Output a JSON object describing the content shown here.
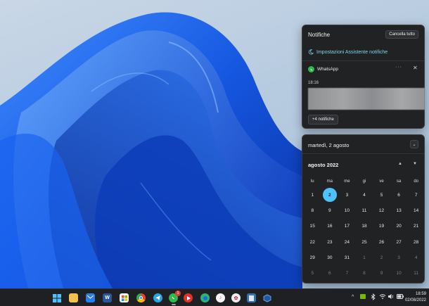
{
  "notifications": {
    "header": "Notifiche",
    "clear_all": "Cancella tutto",
    "assistant_link": "Impostazioni Assistente notifiche",
    "app_name": "WhatsApp",
    "more_dots": "···",
    "close": "✕",
    "time": "18:16",
    "more_button": "+4 notifiche"
  },
  "calendar": {
    "date_header": "martedì, 2 agosto",
    "collapse_icon": "⌄",
    "month_label": "agosto 2022",
    "prev_icon": "▲",
    "next_icon": "▼",
    "weekdays": [
      "lu",
      "ma",
      "me",
      "gi",
      "ve",
      "sa",
      "do"
    ],
    "weeks": [
      [
        "1",
        "2",
        "3",
        "4",
        "5",
        "6",
        "7"
      ],
      [
        "8",
        "9",
        "10",
        "11",
        "12",
        "13",
        "14"
      ],
      [
        "15",
        "16",
        "17",
        "18",
        "19",
        "20",
        "21"
      ],
      [
        "22",
        "23",
        "24",
        "25",
        "26",
        "27",
        "28"
      ],
      [
        "29",
        "30",
        "31",
        "1",
        "2",
        "3",
        "4"
      ],
      [
        "5",
        "6",
        "7",
        "8",
        "9",
        "10",
        "11"
      ]
    ],
    "today": "2"
  },
  "taskbar": {
    "whatsapp_badge": "1",
    "tray_chevron": "^",
    "time": "18:59",
    "date": "02/08/2022"
  },
  "colors": {
    "accent": "#4cc2ff",
    "panel_bg": "#202224",
    "taskbar_bg": "#1f2023",
    "link": "#7fd4e6",
    "whatsapp": "#2fb84c"
  }
}
